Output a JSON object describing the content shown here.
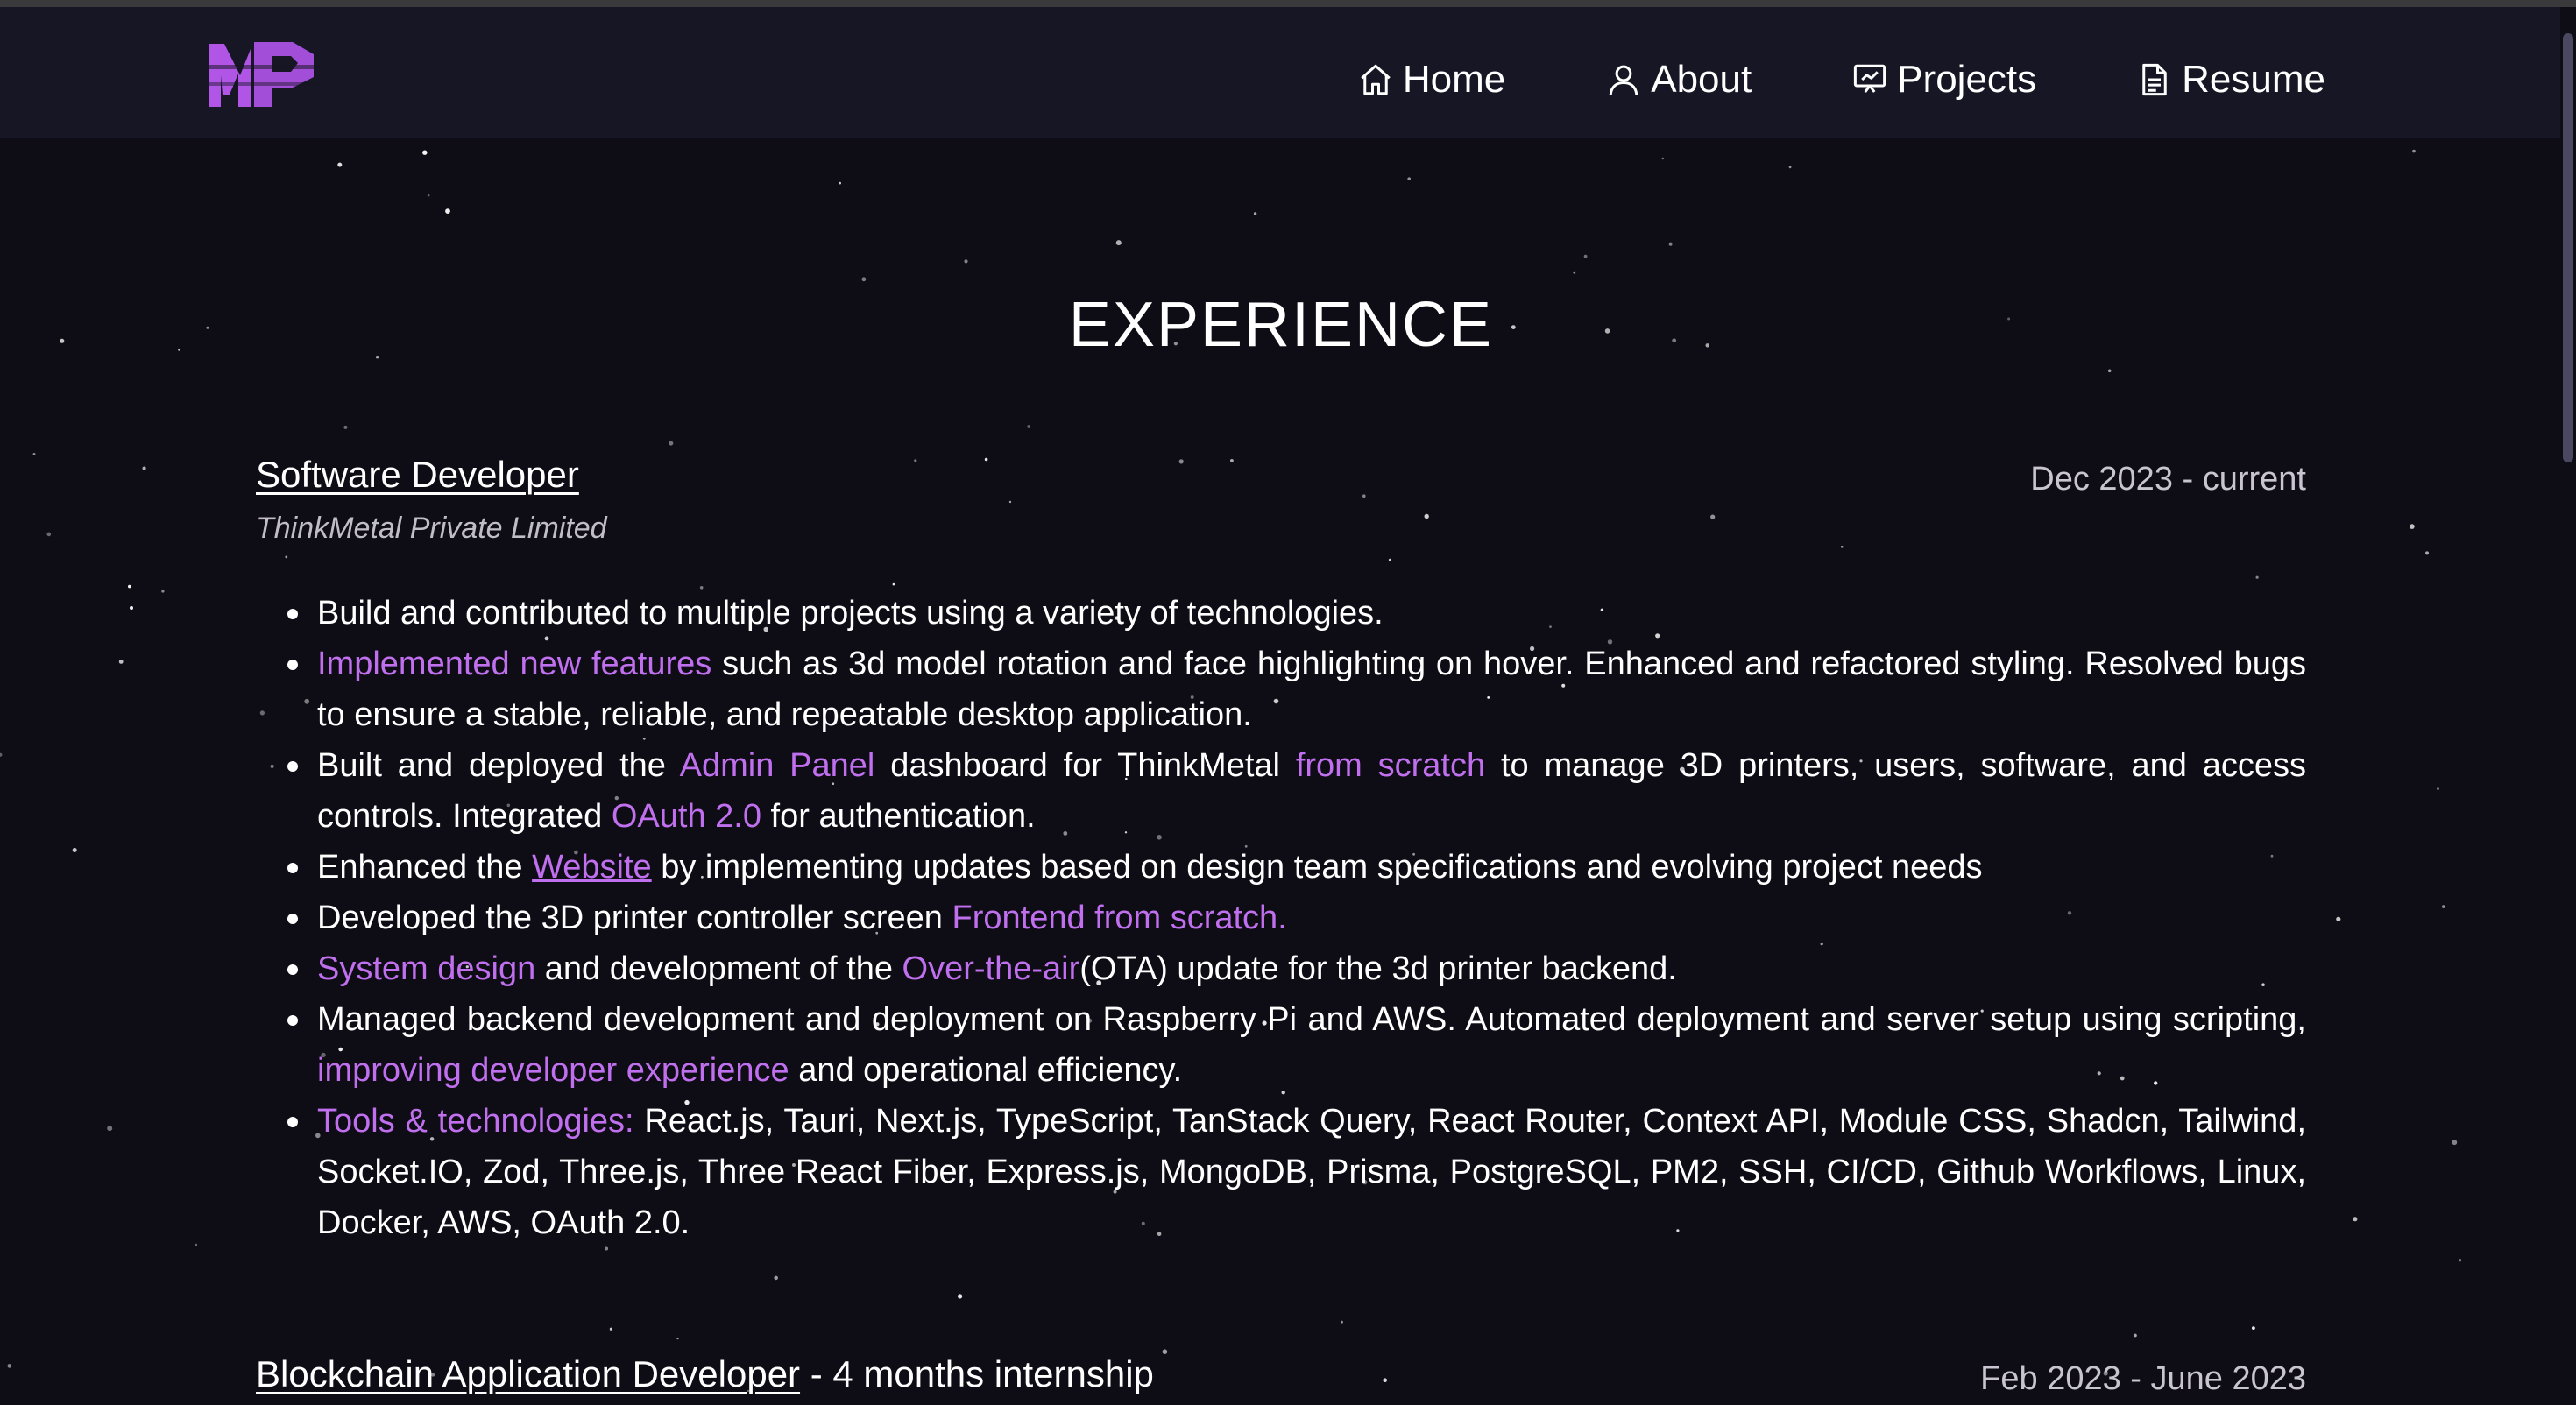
{
  "nav": {
    "logo_text": "MP",
    "items": [
      {
        "label": "Home",
        "icon": "home-icon"
      },
      {
        "label": "About",
        "icon": "user-icon"
      },
      {
        "label": "Projects",
        "icon": "presentation-icon"
      },
      {
        "label": "Resume",
        "icon": "document-icon"
      }
    ]
  },
  "colors": {
    "accent": "#c070ee",
    "background": "#0e0c15",
    "navbar": "#171624"
  },
  "experience": {
    "title": "EXPERIENCE",
    "jobs": [
      {
        "title": "Software Developer",
        "suffix": "",
        "date": "Dec 2023 - current",
        "company": "ThinkMetal Private Limited",
        "bullets": [
          {
            "parts": [
              {
                "t": "Build and contributed to multiple projects using a variety of technologies."
              }
            ]
          },
          {
            "parts": [
              {
                "t": "Implemented new features",
                "hl": true
              },
              {
                "t": " such as 3d model rotation and face highlighting on hover. Enhanced and refactored styling. Resolved bugs to ensure a stable, reliable, and repeatable desktop application."
              }
            ]
          },
          {
            "parts": [
              {
                "t": "Built and deployed the "
              },
              {
                "t": "Admin Panel",
                "hl": true
              },
              {
                "t": " dashboard for ThinkMetal "
              },
              {
                "t": "from scratch",
                "hl": true
              },
              {
                "t": " to manage 3D printers, users, software, and access controls. Integrated "
              },
              {
                "t": "OAuth 2.0",
                "hl": true
              },
              {
                "t": " for authentication."
              }
            ]
          },
          {
            "parts": [
              {
                "t": "Enhanced the "
              },
              {
                "t": "Website",
                "link": true
              },
              {
                "t": " by implementing updates based on design team specifications and evolving project needs"
              }
            ]
          },
          {
            "parts": [
              {
                "t": "Developed the 3D printer controller screen "
              },
              {
                "t": "Frontend from scratch.",
                "hl": true
              }
            ]
          },
          {
            "parts": [
              {
                "t": "System design",
                "hl": true
              },
              {
                "t": " and development of the "
              },
              {
                "t": "Over-the-air",
                "hl": true
              },
              {
                "t": "(OTA) update for the 3d printer backend."
              }
            ]
          },
          {
            "parts": [
              {
                "t": "Managed backend development and deployment on Raspberry Pi and AWS. Automated deployment and server setup using scripting, "
              },
              {
                "t": "improving developer experience",
                "hl": true
              },
              {
                "t": " and operational efficiency."
              }
            ]
          },
          {
            "parts": [
              {
                "t": "Tools & technologies:",
                "hl": true
              },
              {
                "t": " React.js, Tauri, Next.js, TypeScript, TanStack Query, React Router, Context API, Module CSS, Shadcn, Tailwind, Socket.IO, Zod, Three.js, Three React Fiber, Express.js, MongoDB, Prisma, PostgreSQL, PM2, SSH, CI/CD, Github Workflows, Linux, Docker, AWS, OAuth 2.0."
              }
            ]
          }
        ]
      },
      {
        "title": "Blockchain Application Developer",
        "suffix": " - 4 months internship",
        "date": "Feb 2023 - June 2023",
        "company": "",
        "bullets": []
      }
    ]
  }
}
